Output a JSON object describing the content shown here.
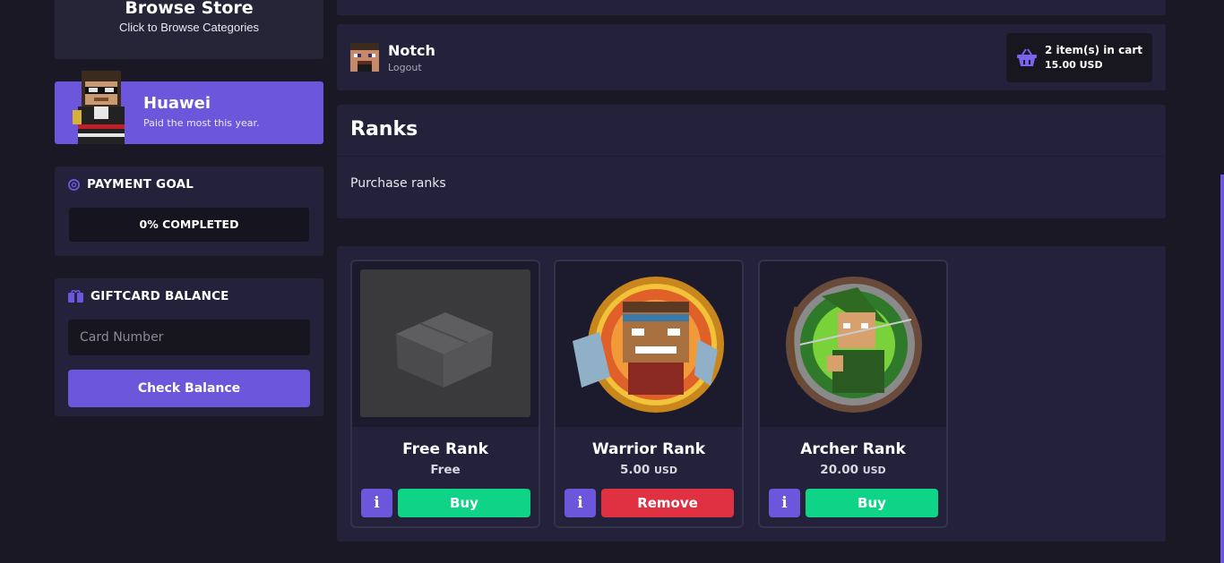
{
  "browse": {
    "title": "Browse Store",
    "subtitle": "Click to Browse Categories"
  },
  "top_donor": {
    "name": "Huawei",
    "subtitle": "Paid the most this year."
  },
  "payment_goal": {
    "heading": "PAYMENT GOAL",
    "icon": "target-icon",
    "progress_text": "0% COMPLETED",
    "progress": 0
  },
  "giftcard": {
    "heading": "GIFTCARD BALANCE",
    "icon": "giftcard-icon",
    "placeholder": "Card Number",
    "button": "Check Balance"
  },
  "user": {
    "name": "Notch",
    "logout": "Logout"
  },
  "cart": {
    "icon": "basket-icon",
    "items_text": "2 item(s) in cart",
    "total": "15.00 USD"
  },
  "category": {
    "title": "Ranks",
    "description": "Purchase ranks"
  },
  "products": [
    {
      "name": "Free Rank",
      "price": "Free",
      "currency": "",
      "info_label": "i",
      "action": "Buy",
      "image": "box-image"
    },
    {
      "name": "Warrior Rank",
      "price": "5.00",
      "currency": "USD",
      "info_label": "i",
      "action": "Remove",
      "image": "warrior-image"
    },
    {
      "name": "Archer Rank",
      "price": "20.00",
      "currency": "USD",
      "info_label": "i",
      "action": "Buy",
      "image": "archer-image"
    }
  ],
  "colors": {
    "accent": "#6c56dc",
    "buy": "#0fd488",
    "remove": "#e03142",
    "panel": "#23223a",
    "background": "#1a1825"
  }
}
